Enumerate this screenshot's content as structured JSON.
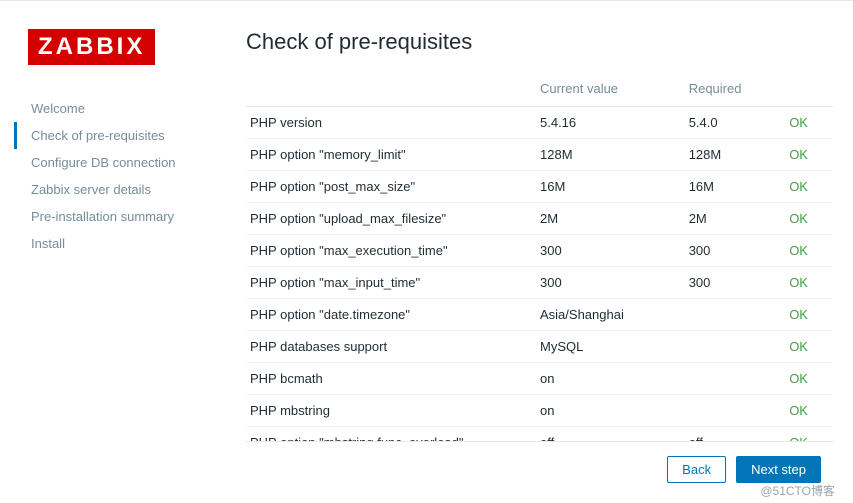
{
  "brand": "ZABBIX",
  "title": "Check of pre-requisites",
  "sidebar": {
    "items": [
      {
        "label": "Welcome"
      },
      {
        "label": "Check of pre-requisites"
      },
      {
        "label": "Configure DB connection"
      },
      {
        "label": "Zabbix server details"
      },
      {
        "label": "Pre-installation summary"
      },
      {
        "label": "Install"
      }
    ]
  },
  "columns": {
    "col1": "",
    "col2": "Current value",
    "col3": "Required",
    "col4": ""
  },
  "rows": [
    {
      "name": "PHP version",
      "current": "5.4.16",
      "required": "5.4.0",
      "status": "OK"
    },
    {
      "name": "PHP option \"memory_limit\"",
      "current": "128M",
      "required": "128M",
      "status": "OK"
    },
    {
      "name": "PHP option \"post_max_size\"",
      "current": "16M",
      "required": "16M",
      "status": "OK"
    },
    {
      "name": "PHP option \"upload_max_filesize\"",
      "current": "2M",
      "required": "2M",
      "status": "OK"
    },
    {
      "name": "PHP option \"max_execution_time\"",
      "current": "300",
      "required": "300",
      "status": "OK"
    },
    {
      "name": "PHP option \"max_input_time\"",
      "current": "300",
      "required": "300",
      "status": "OK"
    },
    {
      "name": "PHP option \"date.timezone\"",
      "current": "Asia/Shanghai",
      "required": "",
      "status": "OK"
    },
    {
      "name": "PHP databases support",
      "current": "MySQL",
      "required": "",
      "status": "OK"
    },
    {
      "name": "PHP bcmath",
      "current": "on",
      "required": "",
      "status": "OK"
    },
    {
      "name": "PHP mbstring",
      "current": "on",
      "required": "",
      "status": "OK"
    },
    {
      "name": "PHP option \"mbstring.func_overload\"",
      "current": "off",
      "required": "off",
      "status": "OK"
    }
  ],
  "buttons": {
    "back": "Back",
    "next": "Next step"
  },
  "watermark": "@51CTO博客"
}
